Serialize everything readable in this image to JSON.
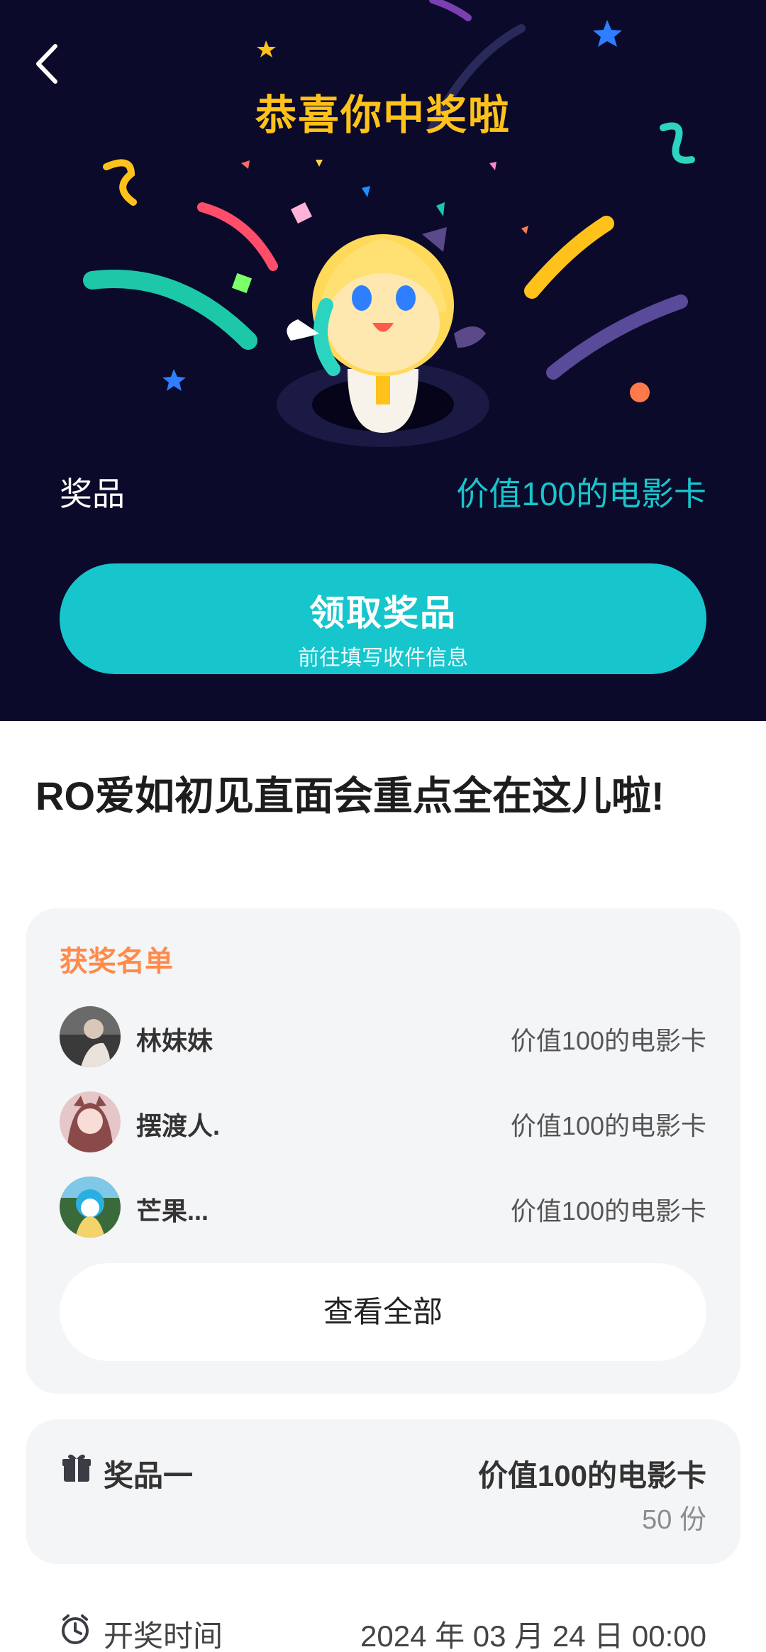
{
  "header": {
    "title": "恭喜你中奖啦"
  },
  "hero": {
    "prize_label": "奖品",
    "prize_value": "价值100的电影卡",
    "claim_button": {
      "label": "领取奖品",
      "sublabel": "前往填写收件信息"
    }
  },
  "article": {
    "title": "RO爱如初见直面会重点全在这儿啦!"
  },
  "winners": {
    "heading": "获奖名单",
    "items": [
      {
        "name": "林妹妹",
        "prize": "价值100的电影卡"
      },
      {
        "name": "摆渡人.",
        "prize": "价值100的电影卡"
      },
      {
        "name": "芒果...",
        "prize": "价值100的电影卡"
      }
    ],
    "view_all_label": "查看全部"
  },
  "prize_item": {
    "label": "奖品一",
    "name": "价值100的电影卡",
    "quantity": "50 份"
  },
  "draw": {
    "label": "开奖时间",
    "time": "2024 年 03 月 24 日 00:00"
  },
  "colors": {
    "hero_bg": "#0b0a2a",
    "accent": "#17c5cc",
    "title_yellow": "#ffc21a",
    "winners_heading": "#ff8a4a"
  },
  "icons": [
    "back-arrow-icon",
    "gift-icon",
    "clock-icon"
  ]
}
